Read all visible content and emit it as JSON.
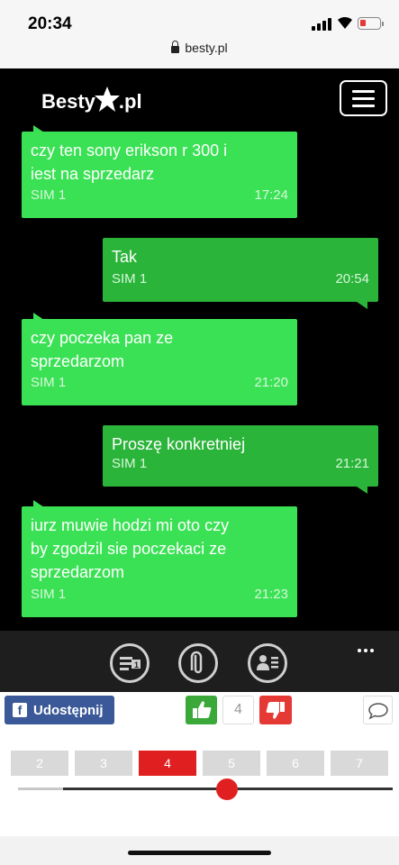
{
  "status_bar": {
    "time": "20:34",
    "url": "besty.pl",
    "battery": "low",
    "colors": {
      "battery": "#e53935"
    }
  },
  "site": {
    "brand_text": "Besty",
    "brand_suffix": ".pl"
  },
  "conversation": [
    {
      "direction": "incoming",
      "text": "czy ten sony erikson r 300 i\niest na sprzedarz",
      "sim": "SIM 1",
      "time": "17:24"
    },
    {
      "direction": "outgoing",
      "text": "Tak",
      "sim": "SIM 1",
      "time": "20:54"
    },
    {
      "direction": "incoming",
      "text": "czy poczeka pan ze\nsprzedarzom",
      "sim": "SIM 1",
      "time": "21:20"
    },
    {
      "direction": "outgoing",
      "text": "Proszę konkretniej",
      "sim": "SIM 1",
      "time": "21:21"
    },
    {
      "direction": "incoming",
      "text": "iurz muwie hodzi mi oto czy\nby zgodzil sie poczekaci ze\nsprzedarzom",
      "sim": "SIM 1",
      "time": "21:23"
    }
  ],
  "toolbar": {
    "icons": [
      "sms-icon",
      "attachment-icon",
      "contact-card-icon",
      "more-icon"
    ]
  },
  "share": {
    "label": "Udostępnij",
    "vote_count": "4"
  },
  "pager": {
    "pages": [
      "2",
      "3",
      "4",
      "5",
      "6",
      "7"
    ],
    "current": "4"
  },
  "colors": {
    "incoming_bubble": "#3be155",
    "outgoing_bubble": "#2bb43a",
    "accent": "#e02020",
    "facebook": "#3b5998"
  }
}
